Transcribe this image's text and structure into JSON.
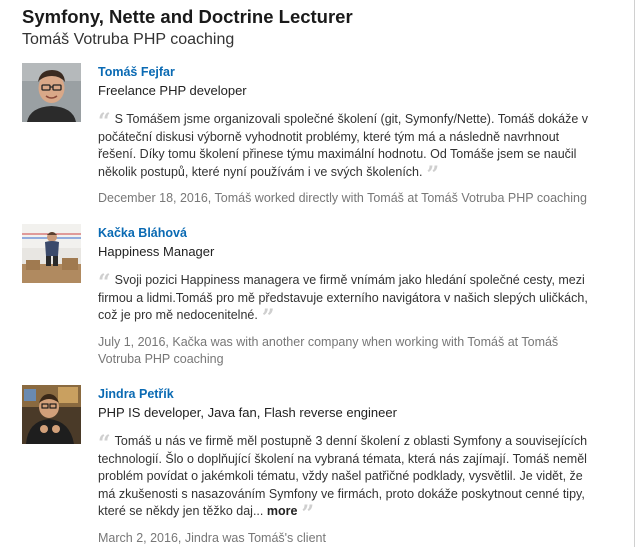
{
  "header": {
    "title": "Symfony, Nette and Doctrine Lecturer",
    "subtitle": "Tomáš Votruba PHP coaching"
  },
  "recommendations": [
    {
      "name": "Tomáš Fejfar",
      "role": "Freelance PHP developer",
      "text": "S Tomášem jsme organizovali společné školení (git, Symonfy/Nette). Tomáš dokáže v počáteční diskusi výborně vyhodnotit problémy, které tým má a následně navrhnout řešení. Díky tomu školení přinese týmu maximální hodnotu. Od Tomáše jsem se naučil několik postupů, které nyní používám i ve svých školeních.",
      "more": "",
      "meta": "December 18, 2016, Tomáš worked directly with Tomáš at Tomáš Votruba PHP coaching",
      "avatar_icon": "person-portrait-icon"
    },
    {
      "name": "Kačka Bláhová",
      "role": "Happiness Manager",
      "text": "Svoji pozici Happiness managera ve firmě vnímám jako hledání společné cesty, mezi firmou a lidmi.Tomáš pro mě představuje externího navigátora v našich slepých uličkách, což je pro mě nedocenitelné.",
      "more": "",
      "meta": "July 1, 2016, Kačka was with another company when working with Tomáš at Tomáš Votruba PHP coaching",
      "avatar_icon": "person-portrait-icon"
    },
    {
      "name": "Jindra Petřík",
      "role": "PHP IS developer, Java fan, Flash reverse engineer",
      "text": "Tomáš u nás ve firmě měl postupně 3 denní školení z oblasti Symfony a souvisejících technologií. Šlo o doplňující školení na vybraná témata, která nás zajímají. Tomáš neměl problém povídat o jakémkoli tématu, vždy našel patřičné podklady, vysvětlil. Je vidět, že má zkušenosti s nasazováním Symfony ve firmách, proto dokáže poskytnout cenné tipy, které se někdy jen těžko daj...",
      "more": "more",
      "meta": "March 2, 2016, Jindra was Tomáš's client",
      "avatar_icon": "person-portrait-icon"
    }
  ],
  "colors": {
    "name_link": "#0a6ab3",
    "meta_text": "#777777",
    "quote_mark": "#cfcfcf"
  }
}
